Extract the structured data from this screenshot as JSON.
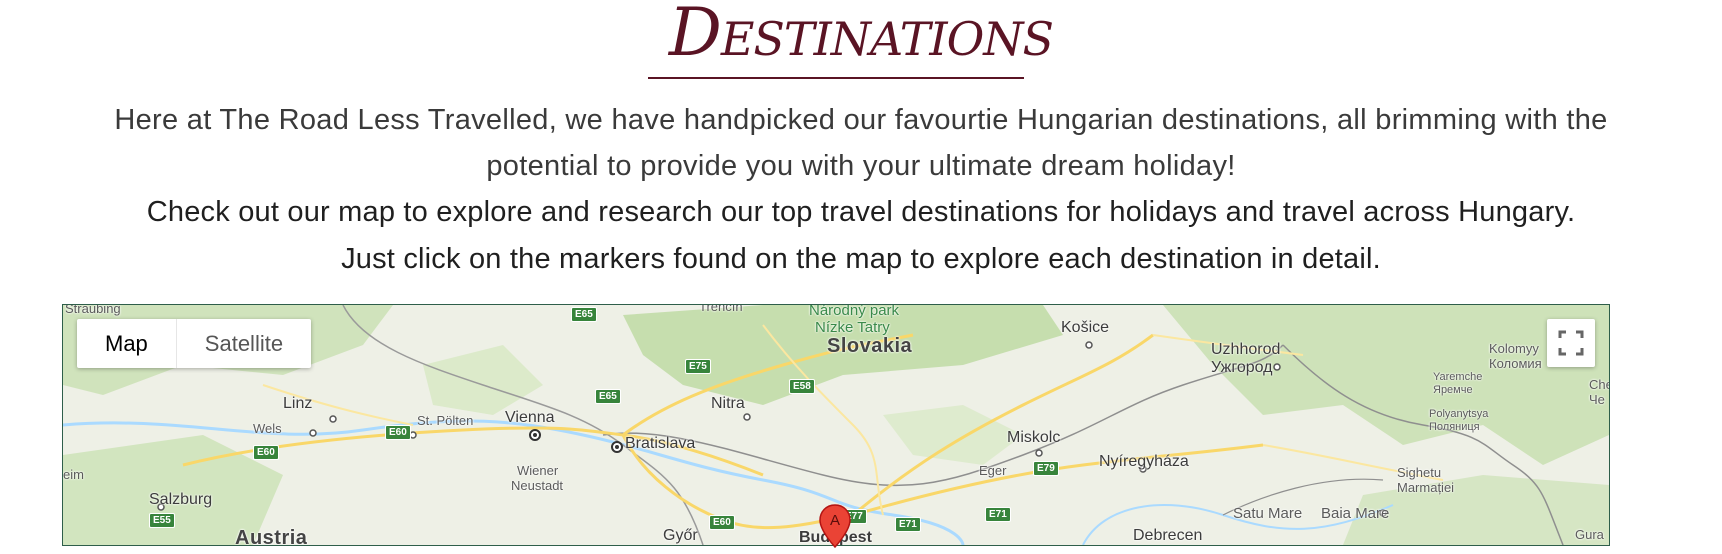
{
  "header": {
    "title": "Destinations"
  },
  "intro": {
    "line1": "Here at The Road Less Travelled, we have handpicked our favourtie Hungarian destinations, all brimming with the",
    "line2": "potential to provide you with your ultimate dream holiday!",
    "cta1": "Check out our map to explore and research our top travel destinations for holidays and travel across Hungary.",
    "cta2": "Just click on the markers found on the map to explore each destination in detail."
  },
  "map": {
    "type_buttons": {
      "map": "Map",
      "satellite": "Satellite"
    },
    "fullscreen_icon": "fullscreen-icon",
    "marker_label": "A",
    "labels": {
      "straubing": "Straubing",
      "trencin": "Trenčín",
      "park1": "Národný park",
      "park2": "Nízke Tatry",
      "kosice": "Košice",
      "slovakia": "Slovakia",
      "uzhhorod": "Uzhhorod",
      "uzhhorod_cyr": "Ужгород",
      "kolomyya": "Kolomyy",
      "kolomyya_cyr": "Коломия",
      "yaremche": "Yaremche",
      "yaremche_cyr": "Яремче",
      "polyanytsya": "Polyanytsya",
      "polyanytsya_cyr": "Поляниця",
      "che": "Che",
      "che2": "Че",
      "linz": "Linz",
      "st_polten": "St. Pölten",
      "vienna": "Vienna",
      "bratislava": "Bratislava",
      "nitra": "Nitra",
      "wels": "Wels",
      "miskolc": "Miskolc",
      "eger": "Eger",
      "nyiregyhaza": "Nyíregyháza",
      "wiener": "Wiener",
      "neustadt": "Neustadt",
      "eim": "eim",
      "salzburg": "Salzburg",
      "sighetu": "Sighetu",
      "marmatiei": "Marmației",
      "satu_mare": "Satu Mare",
      "baia_mare": "Baia Mare",
      "austria": "Austria",
      "gyor": "Győr",
      "budapest": "Budapest",
      "debrecen": "Debrecen",
      "gura": "Gura"
    },
    "shields": [
      "E65",
      "E75",
      "E65",
      "E58",
      "E60",
      "E60",
      "E55",
      "E79",
      "E60",
      "E77",
      "E71",
      "E71"
    ]
  },
  "colors": {
    "title": "#5a1424",
    "water": "#aadaff",
    "forest": "#c6dfae",
    "land": "#eef0e6",
    "marker": "#ea4335"
  }
}
